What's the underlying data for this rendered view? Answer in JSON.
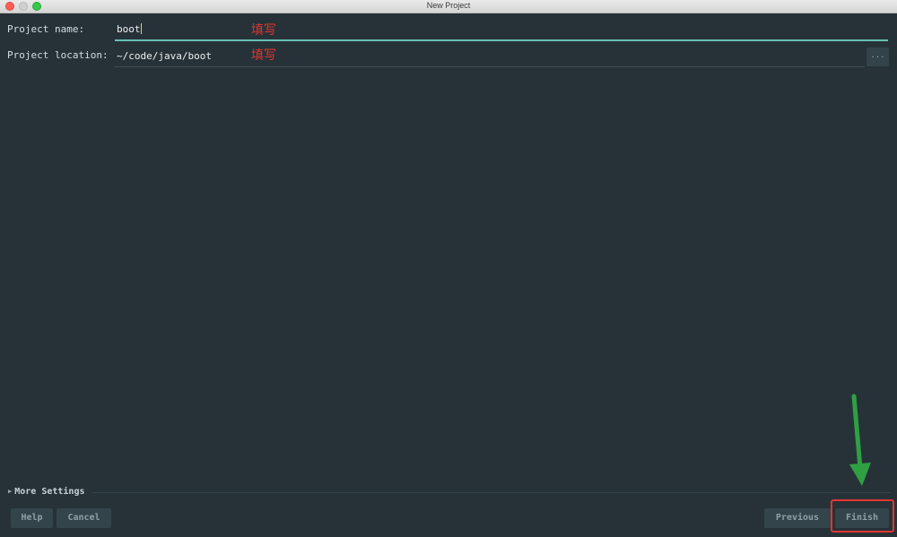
{
  "window": {
    "title": "New Project"
  },
  "form": {
    "project_name": {
      "label": "Project name:",
      "value": "boot",
      "annotation": "填写"
    },
    "project_location": {
      "label": "Project location:",
      "value": "~/code/java/boot",
      "annotation": "填写",
      "browse_label": "..."
    }
  },
  "more_settings": {
    "label": "More Settings"
  },
  "footer": {
    "help_label": "Help",
    "cancel_label": "Cancel",
    "previous_label": "Previous",
    "finish_label": "Finish"
  },
  "icons": {
    "expand": "triangle-right-icon",
    "annotation_arrow": "arrow-down-icon"
  },
  "colors": {
    "background": "#263238",
    "accent": "#67c0b3",
    "annotation_red": "#e2352f",
    "annotation_green": "#2ea043",
    "caret": "#ffcb2e"
  }
}
